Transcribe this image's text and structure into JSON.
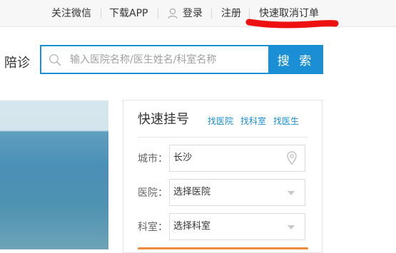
{
  "topbar": {
    "links": [
      "关注微信",
      "下载APP",
      "登录",
      "注册",
      "快速取消订单"
    ],
    "user_icon": "user-icon",
    "accent_scribble_color": "#ee1111"
  },
  "search": {
    "left_label": "陪诊",
    "placeholder": "输入医院名称/医生姓名/科室名称",
    "button_label": "搜 索",
    "accent_color": "#1a8fd6"
  },
  "quick": {
    "title": "快速挂号",
    "links": [
      "找医院",
      "找科室",
      "找医生"
    ],
    "city_label": "城市：",
    "city_value": "长沙",
    "hospital_label": "医院：",
    "hospital_value": "选择医院",
    "department_label": "科室：",
    "department_value": "选择科室",
    "submit_color": "#f08a3c"
  }
}
